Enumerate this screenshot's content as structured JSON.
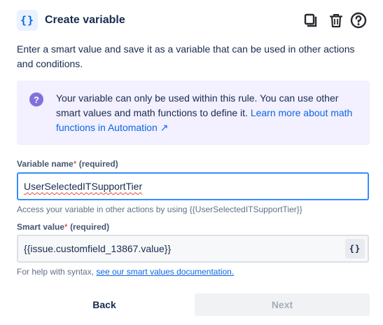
{
  "header": {
    "icon": "curly-braces-icon",
    "icon_glyph": "{}",
    "title": "Create variable",
    "actions": [
      "copy-icon",
      "delete-icon",
      "help-icon"
    ]
  },
  "intro": "Enter a smart value and save it as a variable that can be used in other actions and conditions.",
  "info_panel": {
    "icon": "question-circle-icon",
    "icon_glyph": "?",
    "text": "Your variable can only be used within this rule. You can use other smart values and math functions to define it. ",
    "link_text": "Learn more about math functions in Automation ↗"
  },
  "variable_name": {
    "label": "Variable name",
    "required_star": "*",
    "required_text": "(required)",
    "value": "UserSelectedITSupportTier",
    "helper": "Access your variable in other actions by using {{UserSelectedITSupportTier}}"
  },
  "smart_value": {
    "label": "Smart value",
    "required_star": "*",
    "required_text": "(required)",
    "value": "{{issue.customfield_13867.value}}",
    "button_glyph": "{}",
    "helper_prefix": "For help with syntax, ",
    "helper_link": "see our smart values documentation."
  },
  "footer": {
    "back_label": "Back",
    "next_label": "Next",
    "next_enabled": false
  },
  "colors": {
    "accent": "#0c66e4",
    "focus_border": "#388bff",
    "info_bg": "#f3f0ff",
    "info_icon": "#8270db",
    "required": "#c9372c"
  }
}
